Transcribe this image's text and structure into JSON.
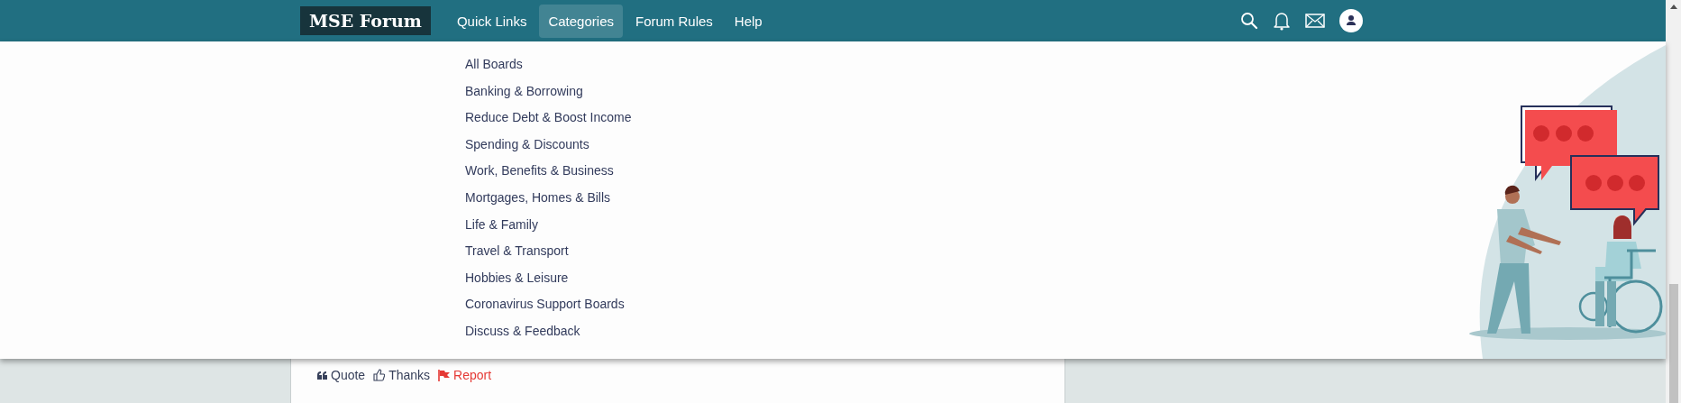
{
  "header": {
    "logo": "MSE Forum",
    "nav": [
      {
        "label": "Quick Links",
        "selected": false
      },
      {
        "label": "Categories",
        "selected": true
      },
      {
        "label": "Forum Rules",
        "selected": false
      },
      {
        "label": "Help",
        "selected": false
      }
    ]
  },
  "categories_menu": {
    "items": [
      {
        "label": "All Boards"
      },
      {
        "label": "Banking & Borrowing"
      },
      {
        "label": "Reduce Debt & Boost Income"
      },
      {
        "label": "Spending & Discounts"
      },
      {
        "label": "Work, Benefits & Business"
      },
      {
        "label": "Mortgages, Homes & Bills"
      },
      {
        "label": "Life & Family"
      },
      {
        "label": "Travel & Transport"
      },
      {
        "label": "Hobbies & Leisure"
      },
      {
        "label": "Coronavirus Support Boards"
      },
      {
        "label": "Discuss & Feedback"
      }
    ]
  },
  "post_actions": [
    {
      "kind": "quote",
      "label": "Quote"
    },
    {
      "kind": "thanks",
      "label": "Thanks"
    },
    {
      "kind": "report",
      "label": "Report"
    }
  ]
}
